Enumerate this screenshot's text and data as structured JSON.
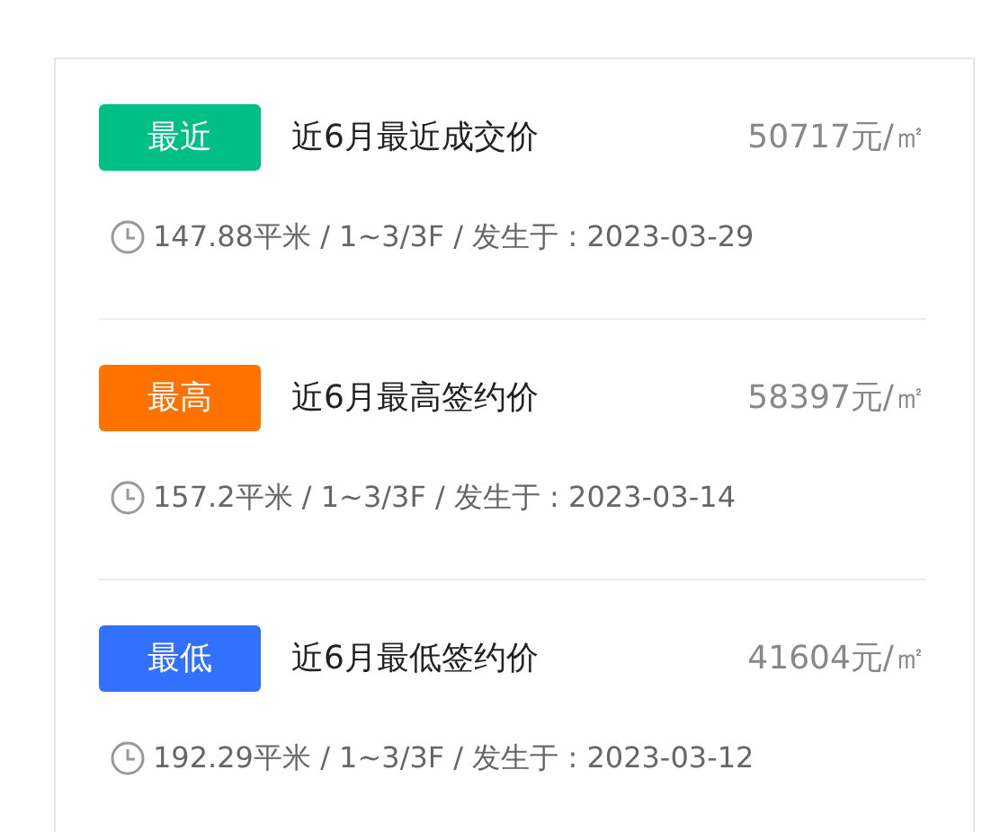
{
  "records": [
    {
      "badge": "最近",
      "color": "#00bf86",
      "title": "近6月最近成交价",
      "price": "50717元/㎡",
      "detail": "147.88平米 / 1~3/3F / 发生于 : 2023-03-29"
    },
    {
      "badge": "最高",
      "color": "#ff7200",
      "title": "近6月最高签约价",
      "price": "58397元/㎡",
      "detail": "157.2平米 / 1~3/3F / 发生于 : 2023-03-14"
    },
    {
      "badge": "最低",
      "color": "#3271fe",
      "title": "近6月最低签约价",
      "price": "41604元/㎡",
      "detail": "192.29平米 / 1~3/3F / 发生于 : 2023-03-12"
    }
  ]
}
